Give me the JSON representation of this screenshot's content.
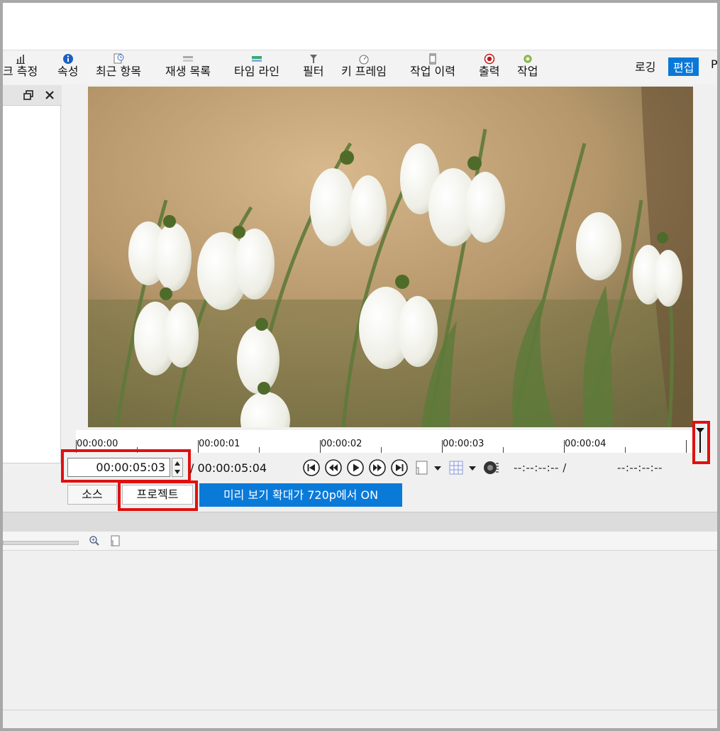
{
  "toolbar": {
    "items": [
      {
        "label": "크 측정",
        "icon": "peak-meter-icon"
      },
      {
        "label": "속성",
        "icon": "info-icon"
      },
      {
        "label": "최근 항목",
        "icon": "recent-icon"
      },
      {
        "label": "재생 목록",
        "icon": "playlist-icon"
      },
      {
        "label": "타임 라인",
        "icon": "timeline-icon"
      },
      {
        "label": "필터",
        "icon": "filter-icon"
      },
      {
        "label": "키 프레임",
        "icon": "keyframe-icon"
      },
      {
        "label": "작업 이력",
        "icon": "history-icon"
      },
      {
        "label": "출력",
        "icon": "export-icon"
      },
      {
        "label": "작업",
        "icon": "jobs-icon"
      }
    ],
    "layouts": {
      "logging": "로깅",
      "editing": "편집",
      "partial": "P"
    }
  },
  "ruler": {
    "labels": [
      "00:00:00",
      "00:00:01",
      "00:00:02",
      "00:00:03",
      "00:00:04"
    ]
  },
  "transport": {
    "timecode": "00:00:05:03",
    "duration": "/ 00:00:05:04",
    "in_point": "--:--:--:-- /",
    "out_point": "--:--:--:--"
  },
  "tabs": {
    "source": "소스",
    "project": "프로젝트"
  },
  "banner": {
    "text": "미리 보기 확대가 720p에서 ON"
  },
  "colors": {
    "accent": "#0a78d7",
    "highlight": "#e01010"
  }
}
